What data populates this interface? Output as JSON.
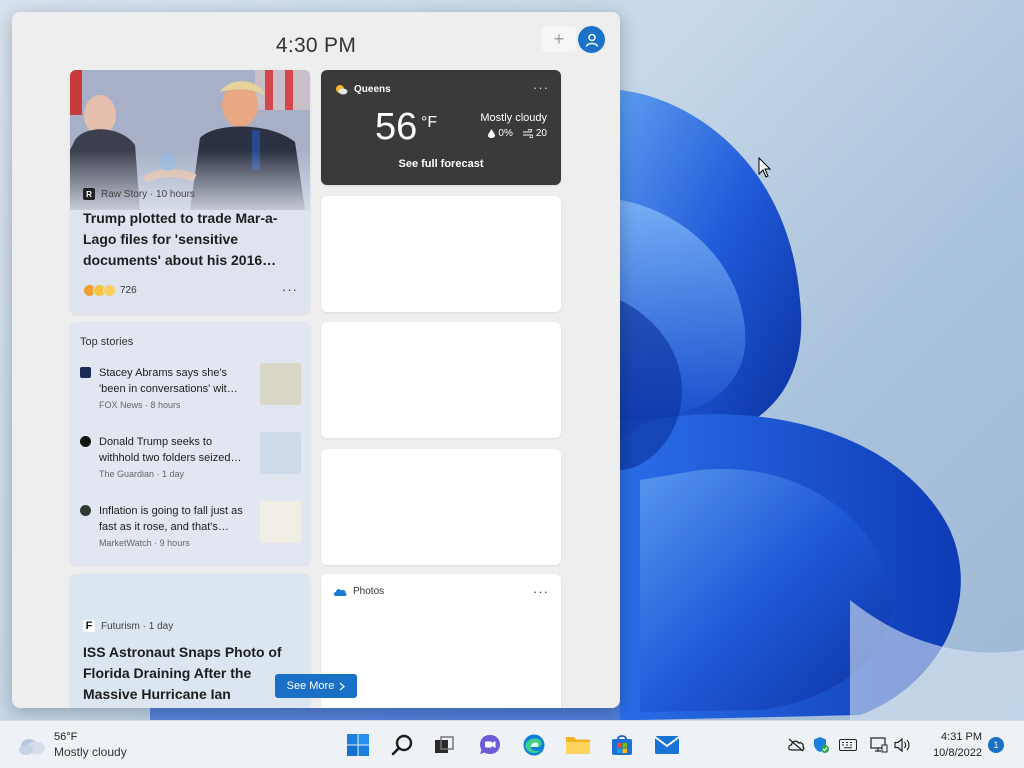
{
  "panel": {
    "time": "4:30 PM",
    "add_label": "+"
  },
  "hero": {
    "source": "Raw Story · 10 hours",
    "source_logo": "R",
    "title": "Trump plotted to trade Mar-a-Lago files for 'sensitive documents' about his 2016…",
    "reaction_count": "726",
    "more": "···"
  },
  "weather": {
    "location": "Queens",
    "temp": "56",
    "unit": "°F",
    "condition": "Mostly cloudy",
    "precip": "0%",
    "wind": "20",
    "forecast_link": "See full forecast",
    "more": "···"
  },
  "top_stories": {
    "heading": "Top stories",
    "items": [
      {
        "title": "Stacey Abrams says she's 'been in conversations' wit…",
        "meta": "FOX News · 8 hours",
        "thumb_color": "#d9d7c7"
      },
      {
        "title": "Donald Trump seeks to withhold two folders seized…",
        "meta": "The Guardian · 1 day",
        "thumb_color": "#cfdbea"
      },
      {
        "title": "Inflation is going to fall just as fast as it rose, and that's…",
        "meta": "MarketWatch · 9 hours",
        "thumb_color": "#f1eee6"
      }
    ]
  },
  "futurism": {
    "source": "Futurism · 1 day",
    "source_logo": "F",
    "title": "ISS Astronaut Snaps Photo of Florida Draining After the Massive Hurricane Ian"
  },
  "photos": {
    "label": "Photos",
    "more": "···"
  },
  "see_more": "See More",
  "taskbar": {
    "weather_temp": "56°F",
    "weather_condition": "Mostly cloudy",
    "time": "4:31 PM",
    "date": "10/8/2022",
    "notifications": "1"
  },
  "colors": {
    "accent": "#1a6fc6",
    "weather_bg": "#3a3a3a"
  }
}
